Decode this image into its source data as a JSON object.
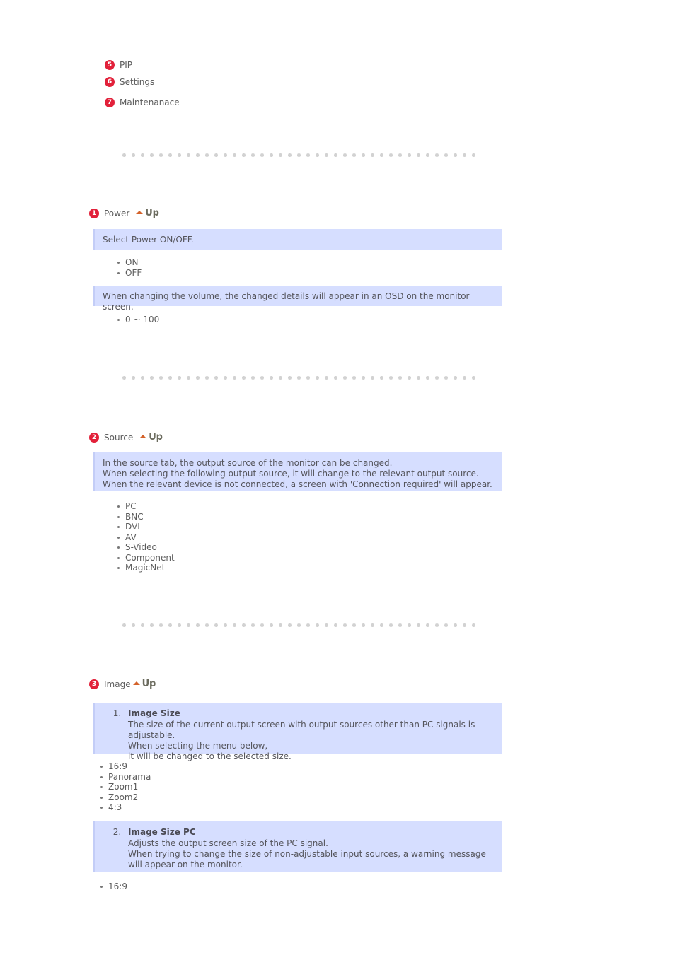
{
  "menu": {
    "items": [
      {
        "number": "5",
        "label": "PIP"
      },
      {
        "number": "6",
        "label": "Settings"
      },
      {
        "number": "7",
        "label": "Maintenanace"
      }
    ]
  },
  "up_link_label": "Up",
  "sections": [
    {
      "number": "1",
      "title": "Power",
      "box_text": "Select Power ON/OFF.",
      "options": [
        "ON",
        "OFF"
      ],
      "box2_text": "When changing the volume, the changed details will appear in an OSD on the monitor screen.",
      "options2": [
        "0 ~ 100"
      ]
    },
    {
      "number": "2",
      "title": "Source",
      "box_lines": [
        "In the source tab, the output source of the monitor can be changed.",
        "When selecting the following output source, it will change to the relevant output source.",
        "When the relevant device is not connected, a screen with 'Connection required' will appear."
      ],
      "options": [
        "PC",
        "BNC",
        "DVI",
        "AV",
        "S-Video",
        "Component",
        "MagicNet"
      ]
    },
    {
      "number": "3",
      "title": "Image",
      "items": [
        {
          "marker": "1.",
          "title": "Image Size",
          "lines": [
            "The size of the current output screen with output sources other than PC signals is adjustable.",
            "When selecting the menu below,",
            "it will be changed to the selected size."
          ],
          "options": [
            "16:9",
            "Panorama",
            "Zoom1",
            "Zoom2",
            "4:3"
          ]
        },
        {
          "marker": "2.",
          "title": "Image Size PC",
          "lines": [
            "Adjusts the output screen size of the PC signal.",
            "When trying to change the size of non-adjustable input sources, a warning message will appear on the monitor."
          ],
          "options": [
            "16:9"
          ]
        }
      ]
    }
  ],
  "colors": {
    "badge_red": "#e2213a",
    "info_box_bg": "#d6deff",
    "info_box_border": "#c3cdf7",
    "divider_dot": "#d2d2d2",
    "up_arrow": "#d4622a",
    "text": "#5c5c5c"
  }
}
